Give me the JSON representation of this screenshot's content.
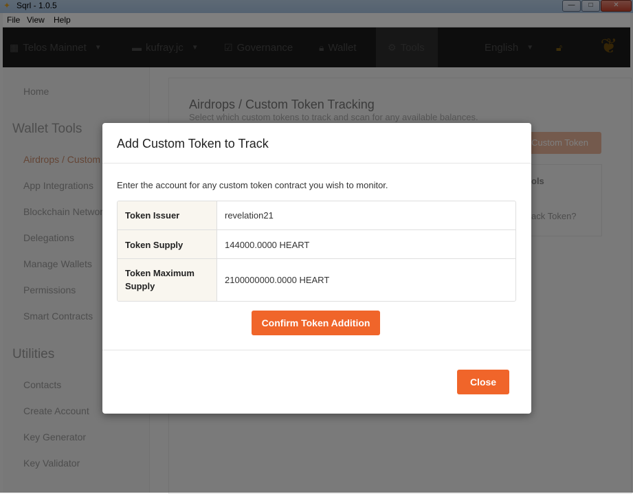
{
  "window": {
    "title": "Sqrl - 1.0.5",
    "minimize_glyph": "—",
    "maximize_glyph": "□",
    "close_glyph": "✕"
  },
  "menu": {
    "file": "File",
    "view": "View",
    "help": "Help"
  },
  "nav": {
    "network": "Telos Mainnet",
    "account": "kufray.jc",
    "governance": "Governance",
    "wallet": "Wallet",
    "tools": "Tools",
    "language": "English",
    "icons": [
      "network-icon",
      "account-icon",
      "governance-icon",
      "lock-icon",
      "gear-icon",
      "lock-icon",
      "squirrel-logo-icon"
    ]
  },
  "sidebar": {
    "home": "Home",
    "wallet_tools_heading": "Wallet Tools",
    "wallet_tools": [
      "Airdrops / Custom",
      "App Integrations",
      "Blockchain Network",
      "Delegations",
      "Manage Wallets",
      "Permissions",
      "Smart Contracts"
    ],
    "utilities_heading": "Utilities",
    "utilities": [
      "Contacts",
      "Create Account",
      "Key Generator",
      "Key Validator"
    ]
  },
  "main": {
    "title": "Airdrops / Custom Token Tracking",
    "subtitle": "Select which custom tokens to track and scan for any available balances.",
    "add_button": "Custom Token",
    "column_head": "ols",
    "row_text": "ack Token?"
  },
  "modal": {
    "title": "Add Custom Token to Track",
    "description": "Enter the account for any custom token contract you wish to monitor.",
    "rows": [
      {
        "label": "Token Issuer",
        "value": "revelation21"
      },
      {
        "label": "Token Supply",
        "value": "144000.0000 HEART"
      },
      {
        "label_line1": "Token Maximum",
        "label_line2": "Supply",
        "value": "2100000000.0000 HEART"
      }
    ],
    "confirm_button": "Confirm Token Addition",
    "close_button": "Close"
  },
  "colors": {
    "accent": "#f0652a",
    "nav_bg": "#1b1b1b",
    "label_bg": "#f9f6ef"
  }
}
